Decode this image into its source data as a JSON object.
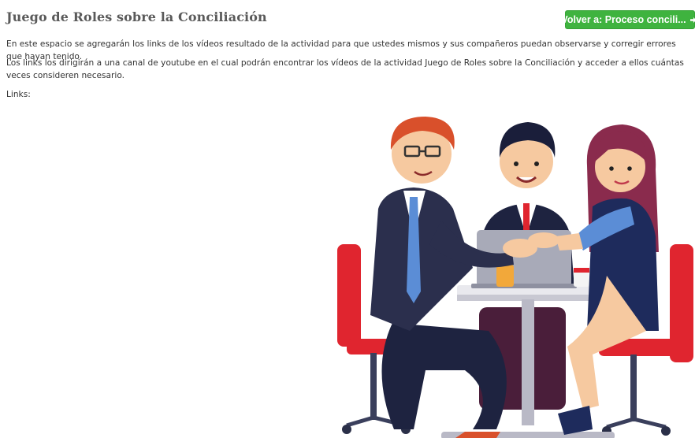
{
  "page": {
    "title": "Juego de Roles sobre la Conciliación",
    "back_button": {
      "label": "Volver a: Proceso concili...",
      "icon": "sign-in-icon",
      "color": "#3fb33f"
    },
    "paragraphs": [
      "En este espacio se agregarán los links de los vídeos resultado de la actividad para que ustedes mismos y sus compañeros puedan observarse y corregir errores que hayan tenido.",
      "Los links los dirigirán a una canal de youtube en el cual podrán encontrar los vídeos de la actividad Juego de Roles sobre la Conciliación y acceder a ellos cuántas veces consideren necesario.",
      "Links:"
    ],
    "illustration": "business-meeting-handshake-illustration"
  }
}
